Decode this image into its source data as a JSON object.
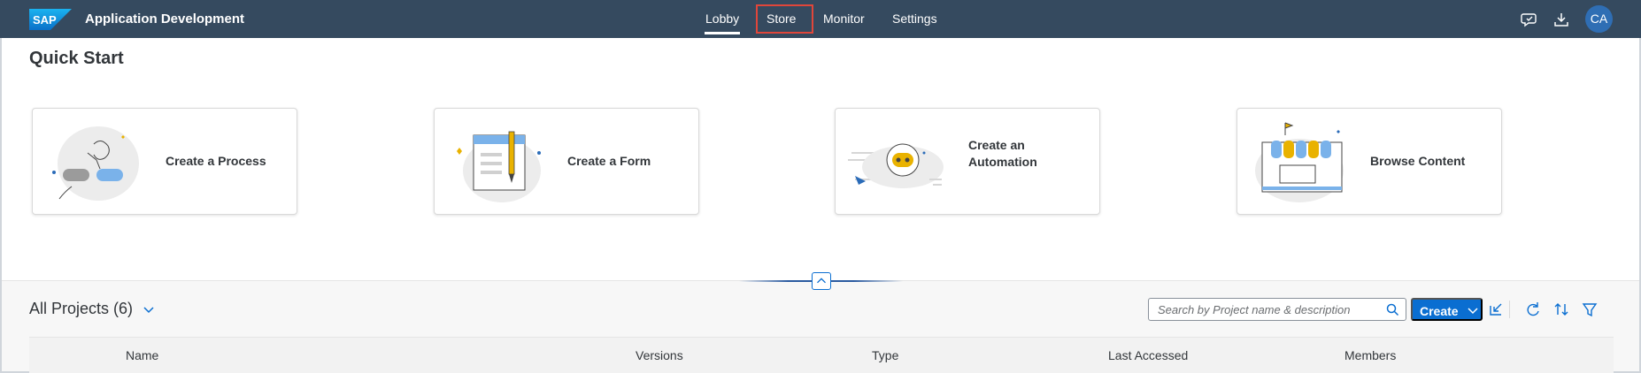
{
  "shell": {
    "logo_text": "SAP",
    "app_title": "Application Development",
    "nav": [
      "Lobby",
      "Store",
      "Monitor",
      "Settings"
    ],
    "active_nav": "Lobby",
    "highlighted_nav": "Store",
    "icons": [
      "feedback-icon",
      "download-icon"
    ],
    "avatar_initials": "CA"
  },
  "quick_start": {
    "title": "Quick Start",
    "cards": [
      {
        "label": "Create a Process",
        "icon": "process-illustration"
      },
      {
        "label": "Create a Form",
        "icon": "form-illustration"
      },
      {
        "label": "Create an Automation",
        "label_line1": "Create an",
        "label_line2": "Automation",
        "icon": "robot-illustration"
      },
      {
        "label": "Browse Content",
        "icon": "store-illustration"
      }
    ]
  },
  "projects": {
    "title": "All Projects (6)",
    "search_placeholder": "Search by Project name & description",
    "create_label": "Create",
    "toolbar_icons": [
      "import-icon",
      "refresh-icon",
      "sort-icon",
      "filter-icon"
    ],
    "columns": [
      "Name",
      "Versions",
      "Type",
      "Last Accessed",
      "Members"
    ]
  },
  "colors": {
    "shell": "#354a5f",
    "accent": "#0a6ed1",
    "highlight_border": "#e0463a"
  }
}
